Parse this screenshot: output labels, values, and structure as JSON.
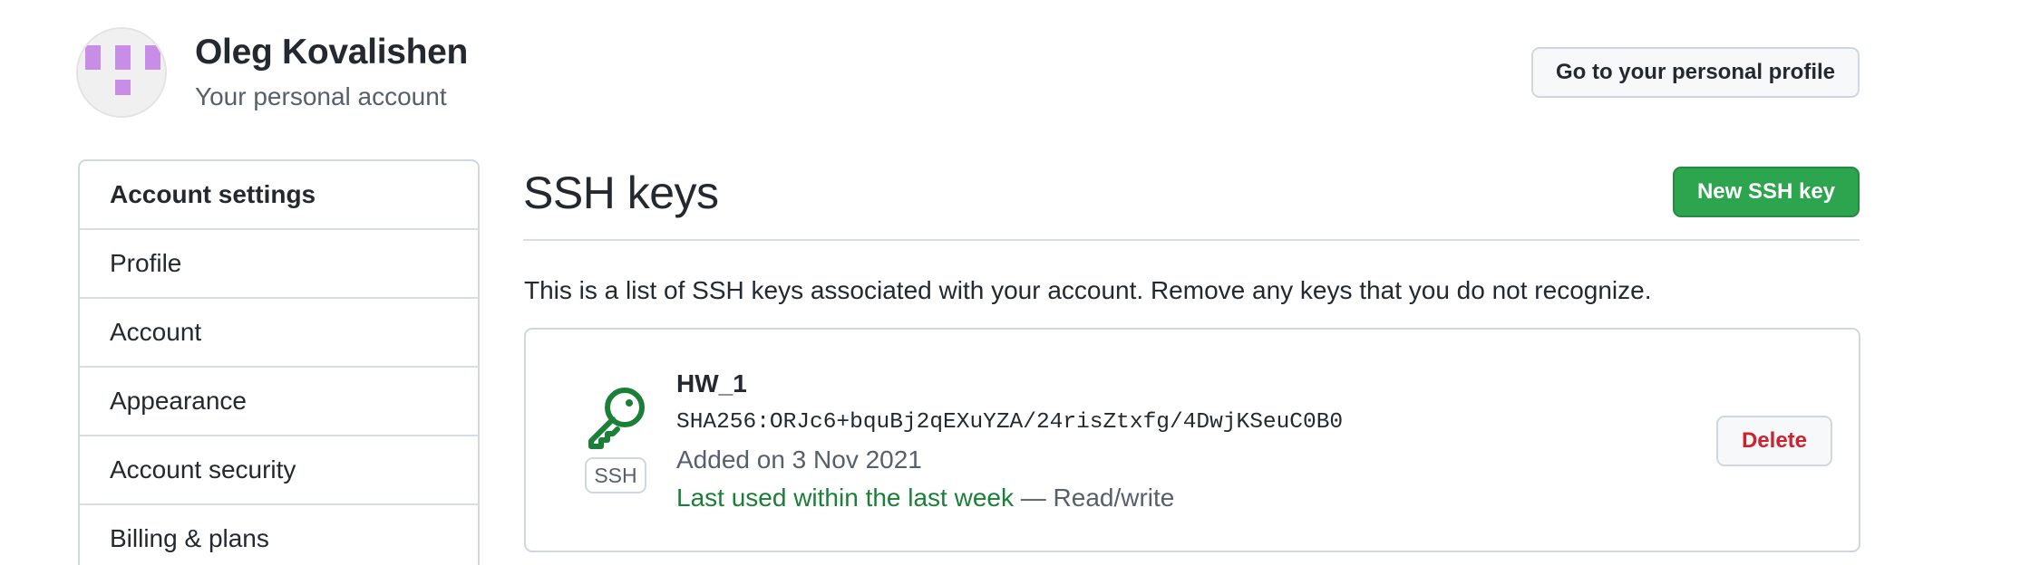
{
  "header": {
    "user_name": "Oleg Kovalishen",
    "subtitle": "Your personal account",
    "profile_button": "Go to your personal profile",
    "avatar_color": "#c88de6"
  },
  "sidebar": {
    "items": [
      {
        "label": "Account settings"
      },
      {
        "label": "Profile"
      },
      {
        "label": "Account"
      },
      {
        "label": "Appearance"
      },
      {
        "label": "Account security"
      },
      {
        "label": "Billing & plans"
      }
    ]
  },
  "main": {
    "title": "SSH keys",
    "new_key_button": "New SSH key",
    "description": "This is a list of SSH keys associated with your account. Remove any keys that you do not recognize.",
    "keys": [
      {
        "title": "HW_1",
        "fingerprint": "SHA256:ORJc6+bquBj2qEXuYZA/24risZtxfg/4DwjKSeuC0B0",
        "added": "Added on 3 Nov 2021",
        "last_used": "Last used within the last week",
        "access": " — Read/write",
        "badge": "SSH",
        "delete_button": "Delete",
        "icon": "key-icon"
      }
    ]
  },
  "colors": {
    "primary_green": "#2da44e",
    "success_text": "#1a7f37",
    "danger_text": "#cf222e",
    "muted_text": "#57606a",
    "border": "#d0d7de"
  }
}
